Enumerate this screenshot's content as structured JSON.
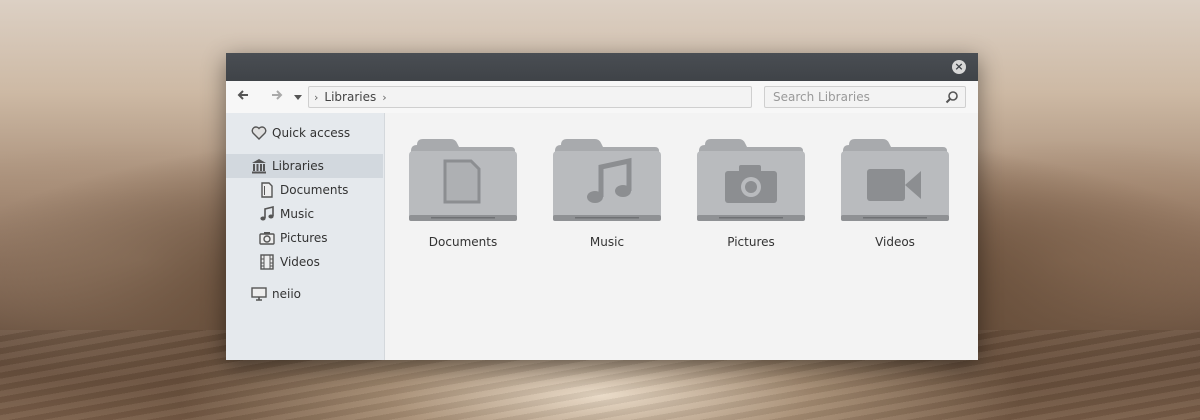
{
  "window": {
    "close_glyph": "×"
  },
  "navbar": {
    "back_icon": "arrow-left-icon",
    "forward_icon": "arrow-right-icon",
    "dropdown_icon": "chevron-down-icon",
    "breadcrumb": [
      "Libraries"
    ],
    "search_placeholder": "Search Libraries"
  },
  "sidebar": {
    "items": [
      {
        "label": "Quick access",
        "icon": "heart-icon"
      },
      {
        "label": "Libraries",
        "icon": "library-icon",
        "selected": true
      },
      {
        "label": "Documents",
        "icon": "document-icon"
      },
      {
        "label": "Music",
        "icon": "music-note-icon"
      },
      {
        "label": "Pictures",
        "icon": "camera-icon"
      },
      {
        "label": "Videos",
        "icon": "film-icon"
      },
      {
        "label": "neiio",
        "icon": "computer-icon"
      }
    ]
  },
  "main": {
    "folders": [
      {
        "label": "Documents",
        "icon": "document-icon"
      },
      {
        "label": "Music",
        "icon": "music-note-icon"
      },
      {
        "label": "Pictures",
        "icon": "camera-icon"
      },
      {
        "label": "Videos",
        "icon": "video-camera-icon"
      }
    ]
  },
  "colors": {
    "titlebar": "#43474c",
    "sidebar_bg": "#e5e9ed",
    "sidebar_selected": "#d2d8de",
    "content_bg": "#f3f3f3",
    "folder_gray": "#b4b6b9"
  }
}
